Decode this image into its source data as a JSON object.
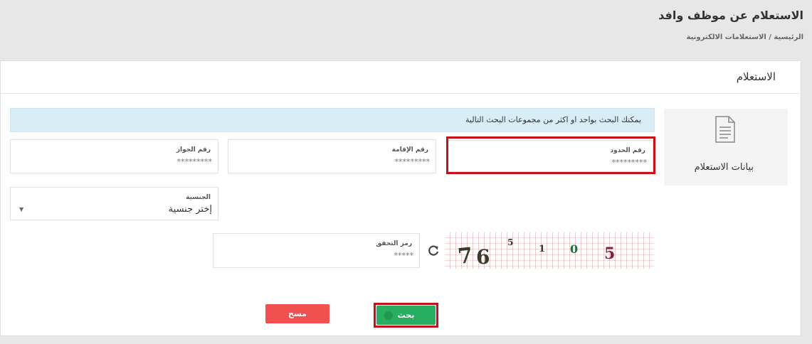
{
  "header": {
    "title": "الاستعلام عن موظف وافد",
    "breadcrumb": "الرئيسية / الاستعلامات الالكترونية"
  },
  "card": {
    "title": "الاستعلام",
    "side_panel_label": "بيانات الاستعلام",
    "info_text": "يمكنك البحث بواحد او اكثر من مجموعات البحث التالية"
  },
  "fields": {
    "border_number": {
      "label": "رقم الحدود",
      "placeholder": "*********"
    },
    "iqama_number": {
      "label": "رقم الإقامة",
      "placeholder": "*********"
    },
    "passport_number": {
      "label": "رقم الجواز",
      "placeholder": "*********"
    },
    "nationality": {
      "label": "الجنسية",
      "selected": "إختر جنسية"
    },
    "captcha": {
      "label": "رمز التحقق",
      "placeholder": "*****"
    }
  },
  "captcha_image": {
    "text": "76 5 1 0 5"
  },
  "buttons": {
    "search": "بحث",
    "clear": "مسح"
  },
  "colors": {
    "search_button": "#27ae60",
    "clear_button": "#f05050",
    "info_background": "#d9edf7",
    "highlight": "#c8101a"
  }
}
